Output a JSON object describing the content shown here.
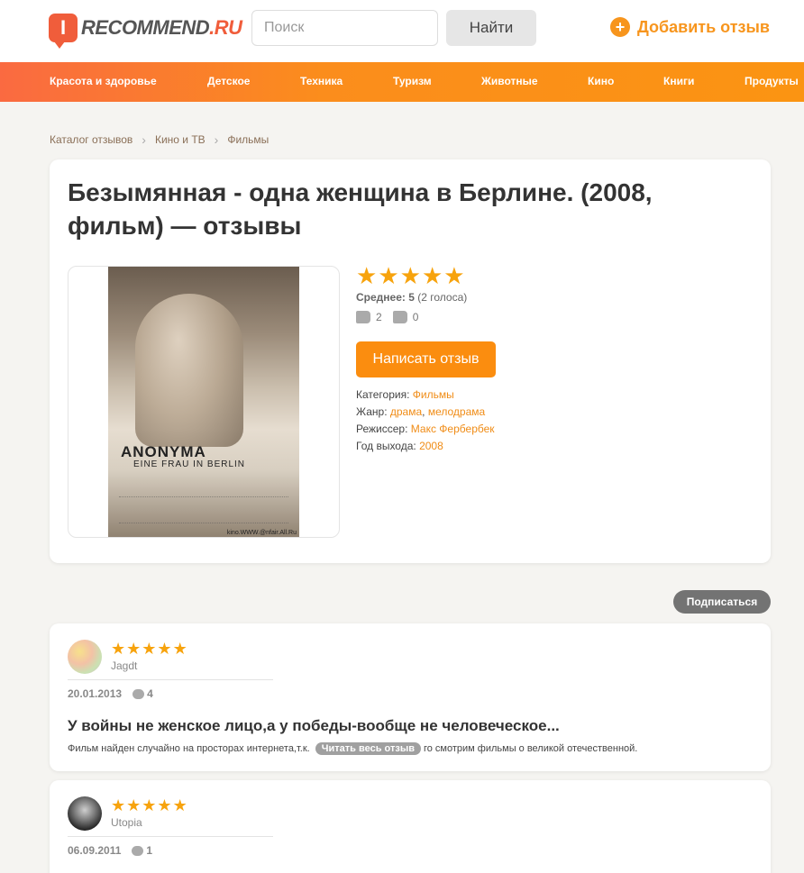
{
  "header": {
    "logo_badge": "I",
    "logo_text_main": "RECOMMEND",
    "logo_text_domain": ".RU",
    "search_placeholder": "Поиск",
    "search_button": "Найти",
    "add_review_icon": "+",
    "add_review": "Добавить отзыв"
  },
  "nav": {
    "items": [
      "Красота и здоровье",
      "Детское",
      "Техника",
      "Туризм",
      "Животные",
      "Кино",
      "Книги",
      "Продукты"
    ]
  },
  "breadcrumb": {
    "items": [
      "Каталог отзывов",
      "Кино и ТВ",
      "Фильмы"
    ],
    "separator": "›"
  },
  "product": {
    "title": "Безымянная - одна женщина в Берлине. (2008, фильм) — отзывы",
    "poster": {
      "title": "ANONYMA",
      "subtitle": "EINE FRAU IN BERLIN",
      "url": "kino.WWW.@nfair.All.Ru"
    },
    "rating": {
      "stars": 5,
      "star_glyph": "★",
      "average_label": "Среднее: 5",
      "votes": "(2 голоса)",
      "likes": "2",
      "dislikes": "0"
    },
    "write_button": "Написать отзыв",
    "props": {
      "category_label": "Категория:",
      "category_value": "Фильмы",
      "genre_label": "Жанр:",
      "genre_1": "драма",
      "genre_sep": ",",
      "genre_2": "мелодрама",
      "director_label": "Режиссер:",
      "director_value": "Макс Фербербек",
      "year_label": "Год выхода:",
      "year_value": "2008"
    }
  },
  "subscribe_button": "Подписаться",
  "reviews": [
    {
      "username": "Jagdt",
      "date": "20.01.2013",
      "comments": "4",
      "title": "У войны не женское лицо,а у победы-вообще не человеческое...",
      "excerpt_start": "Фильм найден случайно на просторах интернета,т.к.",
      "read_more": "Читать весь отзыв",
      "excerpt_end": "го смотрим фильмы о великой отечественной."
    },
    {
      "username": "Utopia",
      "date": "06.09.2011",
      "comments": "1"
    }
  ],
  "colors": {
    "brand": "#f05d3b",
    "accent_orange": "#fb8d0f",
    "star": "#f7a30d"
  }
}
